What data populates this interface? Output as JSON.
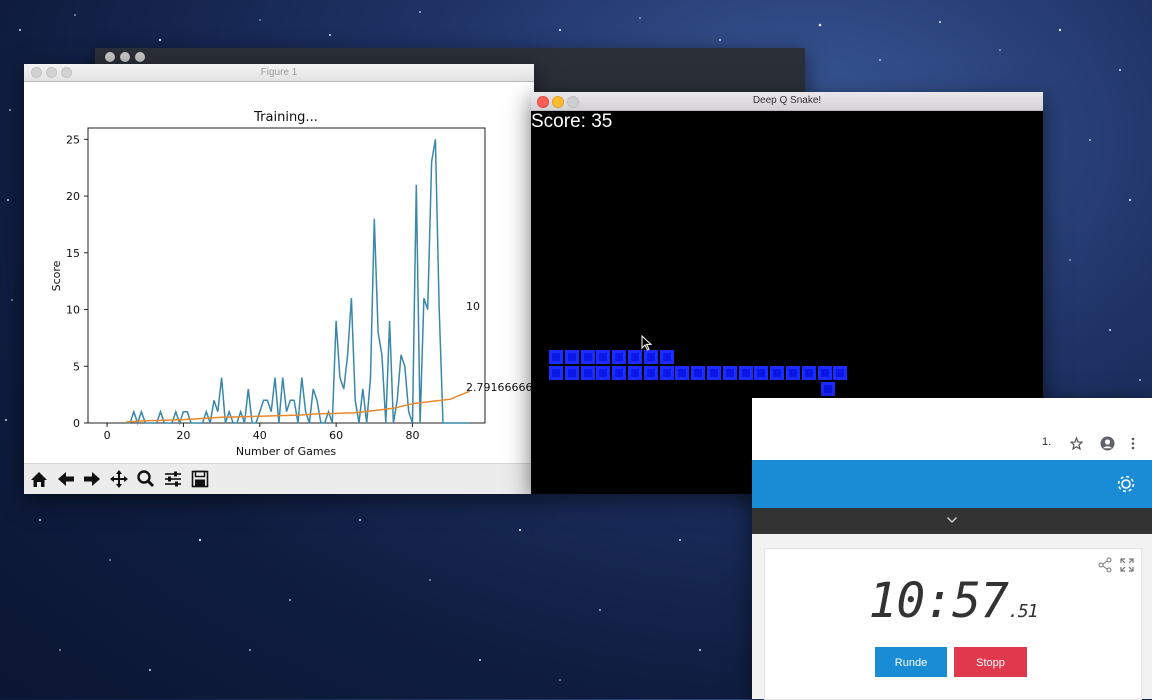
{
  "figure_window": {
    "title": "Figure 1"
  },
  "chart_data": {
    "type": "line",
    "title": "Training...",
    "xlabel": "Number of Games",
    "ylabel": "Score",
    "xlim": [
      -5,
      99
    ],
    "ylim": [
      0,
      26
    ],
    "xticks": [
      0,
      20,
      40,
      60,
      80
    ],
    "yticks": [
      0,
      5,
      10,
      15,
      20,
      25
    ],
    "grid": false,
    "series": [
      {
        "name": "scores",
        "color": "#3a87a8",
        "x": [
          5,
          6,
          7,
          8,
          9,
          10,
          11,
          12,
          13,
          14,
          15,
          16,
          17,
          18,
          19,
          20,
          21,
          22,
          23,
          24,
          25,
          26,
          27,
          28,
          29,
          30,
          31,
          32,
          33,
          34,
          35,
          36,
          37,
          38,
          39,
          40,
          41,
          42,
          43,
          44,
          45,
          46,
          47,
          48,
          49,
          50,
          51,
          52,
          53,
          54,
          55,
          56,
          57,
          58,
          59,
          60,
          61,
          62,
          63,
          64,
          65,
          66,
          67,
          68,
          69,
          70,
          71,
          72,
          73,
          74,
          75,
          76,
          77,
          78,
          79,
          80,
          81,
          82,
          83,
          84,
          85,
          86,
          87,
          88,
          89,
          90,
          91,
          92,
          93,
          94,
          95
        ],
        "values": [
          0,
          0,
          1,
          0,
          1,
          0,
          0,
          0,
          0,
          1,
          0,
          0,
          0,
          1,
          0,
          1,
          1,
          0,
          0,
          0,
          0,
          1,
          0,
          2,
          1,
          4,
          0,
          1,
          0,
          0,
          1,
          0,
          3,
          0,
          0,
          1,
          2,
          2,
          1,
          4,
          0,
          4,
          1,
          2,
          2,
          0,
          4,
          1,
          0,
          3,
          2,
          0,
          0,
          1,
          0,
          9,
          4,
          3,
          6,
          11,
          2,
          0,
          3,
          0,
          4,
          18,
          8,
          6,
          0,
          9,
          0,
          2,
          6,
          5,
          1,
          0,
          21,
          0,
          11,
          10,
          23,
          25,
          10,
          0,
          0,
          0,
          0,
          0,
          0,
          0,
          0
        ]
      },
      {
        "name": "mean",
        "color": "#e8892c",
        "x": [
          5,
          10,
          15,
          20,
          25,
          30,
          35,
          40,
          45,
          50,
          55,
          60,
          65,
          70,
          75,
          80,
          85,
          90,
          92,
          95
        ],
        "values": [
          0.1,
          0.2,
          0.25,
          0.3,
          0.4,
          0.5,
          0.55,
          0.6,
          0.65,
          0.7,
          0.8,
          0.85,
          0.9,
          1.1,
          1.3,
          1.7,
          1.9,
          2.1,
          2.4,
          2.79
        ]
      }
    ],
    "annotations": [
      "10",
      "2.791666666"
    ]
  },
  "snake_window": {
    "title": "Deep Q Snake!",
    "score_text": "Score: 35"
  },
  "browser": {
    "url_fragment": "1.",
    "timer_main": "10:57",
    "timer_fraction": ".51",
    "round_button": "Runde",
    "stop_button": "Stopp"
  },
  "colors": {
    "snake_body": "#1c2bff",
    "food": "#e00000",
    "round_button": "#1a8cd6",
    "stop_button": "#e0394d",
    "header_blue": "#1a8cd6"
  }
}
